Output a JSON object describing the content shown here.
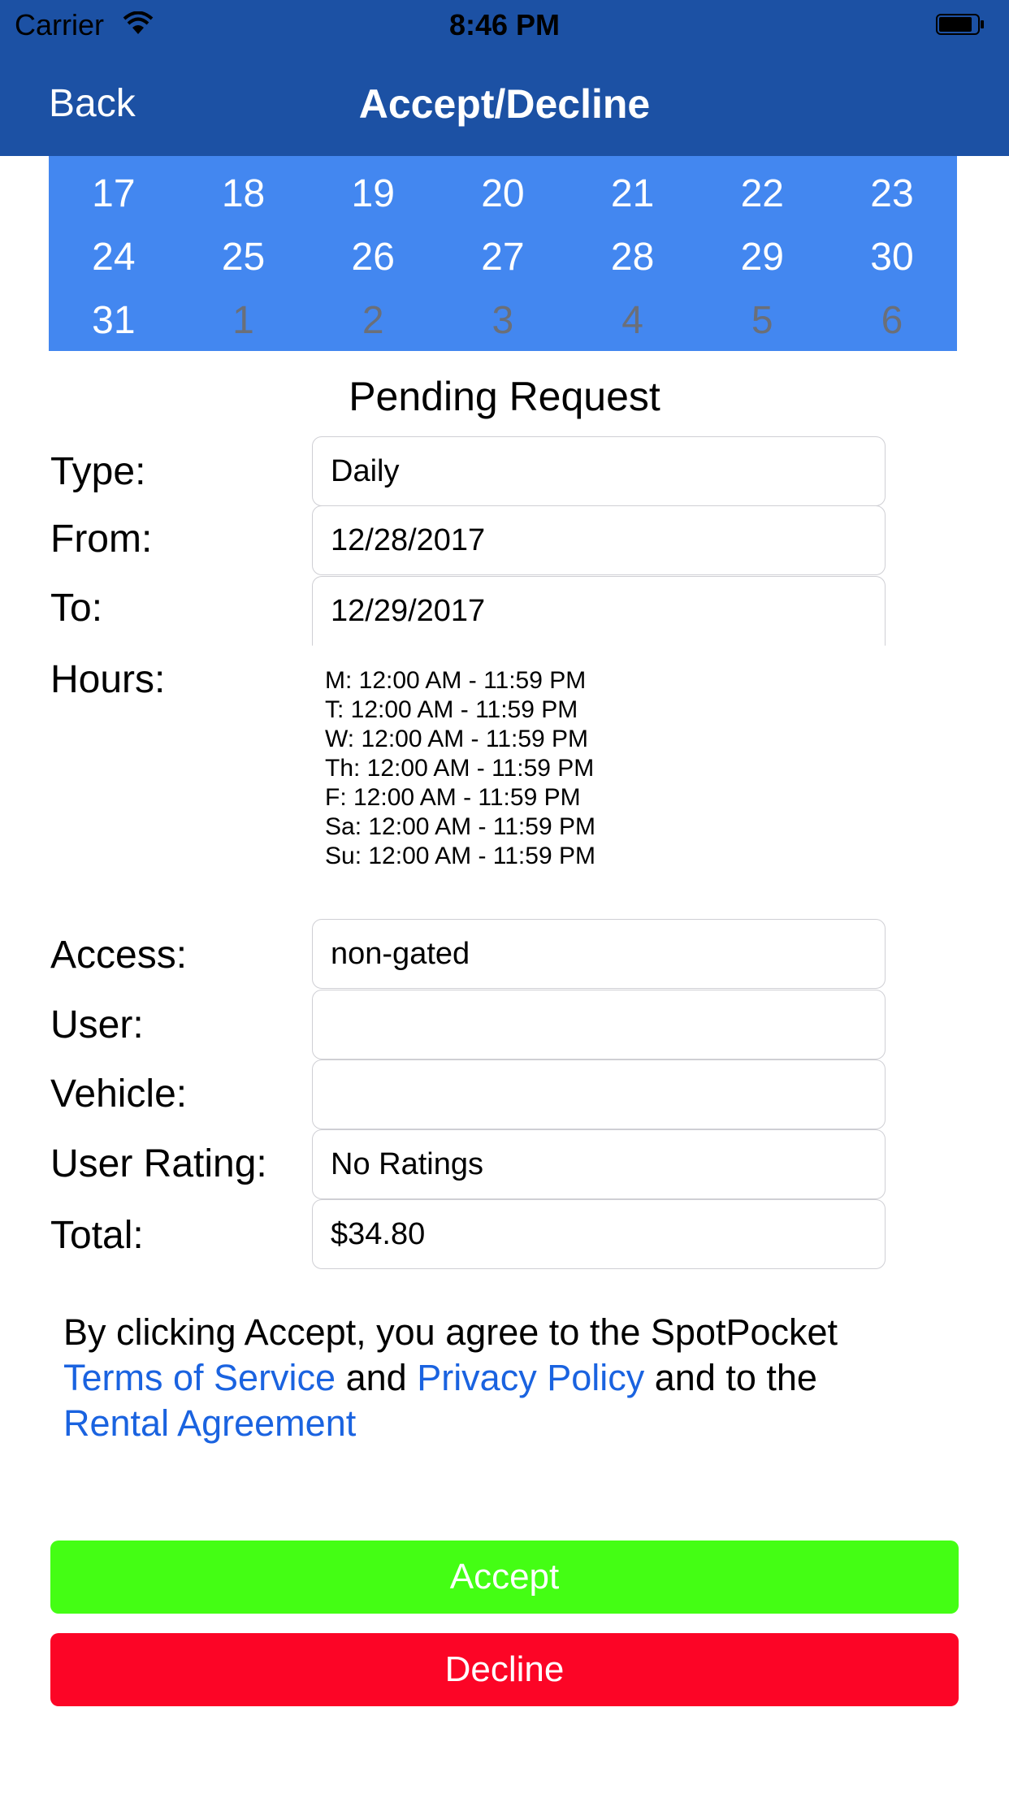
{
  "status_bar": {
    "carrier": "Carrier",
    "time": "8:46 PM",
    "wifi_icon": "wifi-icon",
    "battery_icon": "battery-icon"
  },
  "nav": {
    "back_label": "Back",
    "title": "Accept/Decline",
    "background_color": "#1c51a4"
  },
  "calendar": {
    "background_color": "#4387f0",
    "rows": [
      [
        "17",
        "18",
        "19",
        "20",
        "21",
        "22",
        "23"
      ],
      [
        "24",
        "25",
        "26",
        "27",
        "28",
        "29",
        "30"
      ],
      [
        "31",
        "1",
        "2",
        "3",
        "4",
        "5",
        "6"
      ]
    ]
  },
  "request": {
    "heading": "Pending Request",
    "type_label": "Type:",
    "type_value": "Daily",
    "from_label": "From:",
    "from_value": "12/28/2017",
    "to_label": "To:",
    "to_value": "12/29/2017",
    "hours_label": "Hours:",
    "hours": [
      "M: 12:00 AM - 11:59 PM",
      "T: 12:00 AM - 11:59 PM",
      "W: 12:00 AM - 11:59 PM",
      "Th: 12:00 AM - 11:59 PM",
      "F: 12:00 AM - 11:59 PM",
      "Sa: 12:00 AM - 11:59 PM",
      "Su: 12:00 AM - 11:59 PM"
    ],
    "access_label": "Access:",
    "access_value": "non-gated",
    "user_label": "User:",
    "user_value": "",
    "vehicle_label": "Vehicle:",
    "vehicle_value": "",
    "rating_label": "User Rating:",
    "rating_value": "No Ratings",
    "total_label": "Total:",
    "total_value": "$34.80"
  },
  "terms": {
    "prefix": "By clicking Accept, you agree to the SpotPocket ",
    "terms_link": "Terms of Service",
    "and": " and ",
    "privacy_link": "Privacy Policy",
    "and_to_the": " and to the ",
    "rental_link": "Rental Agreement",
    "link_color": "#1a63e0"
  },
  "actions": {
    "accept_label": "Accept",
    "accept_color": "#44fe14",
    "decline_label": "Decline",
    "decline_color": "#fc0526"
  }
}
